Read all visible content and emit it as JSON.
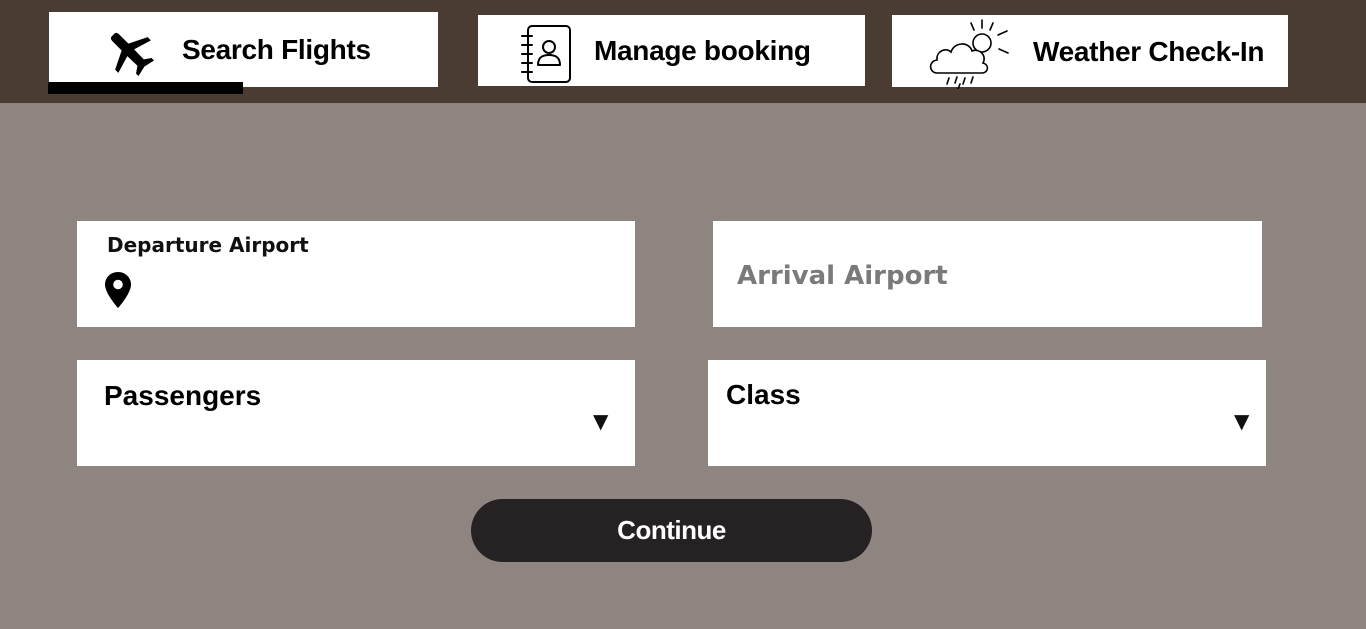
{
  "tabs": [
    {
      "label": "Search Flights",
      "icon": "airplane-icon",
      "active": true
    },
    {
      "label": "Manage booking",
      "icon": "address-book-icon",
      "active": false
    },
    {
      "label": "Weather Check-In",
      "icon": "cloud-rain-sun-icon",
      "active": false
    }
  ],
  "form": {
    "departure": {
      "label": "Departure Airport",
      "value": "",
      "icon": "location-pin-icon"
    },
    "arrival": {
      "placeholder": "Arrival Airport",
      "value": ""
    },
    "passengers": {
      "label": "Passengers"
    },
    "class": {
      "label": "Class"
    },
    "caret": "▼",
    "continue_label": "Continue"
  },
  "colors": {
    "header_bg": "#4b3c33",
    "page_bg": "#8f8580",
    "button_bg": "#262223",
    "active_tab_indicator": "#000000"
  }
}
